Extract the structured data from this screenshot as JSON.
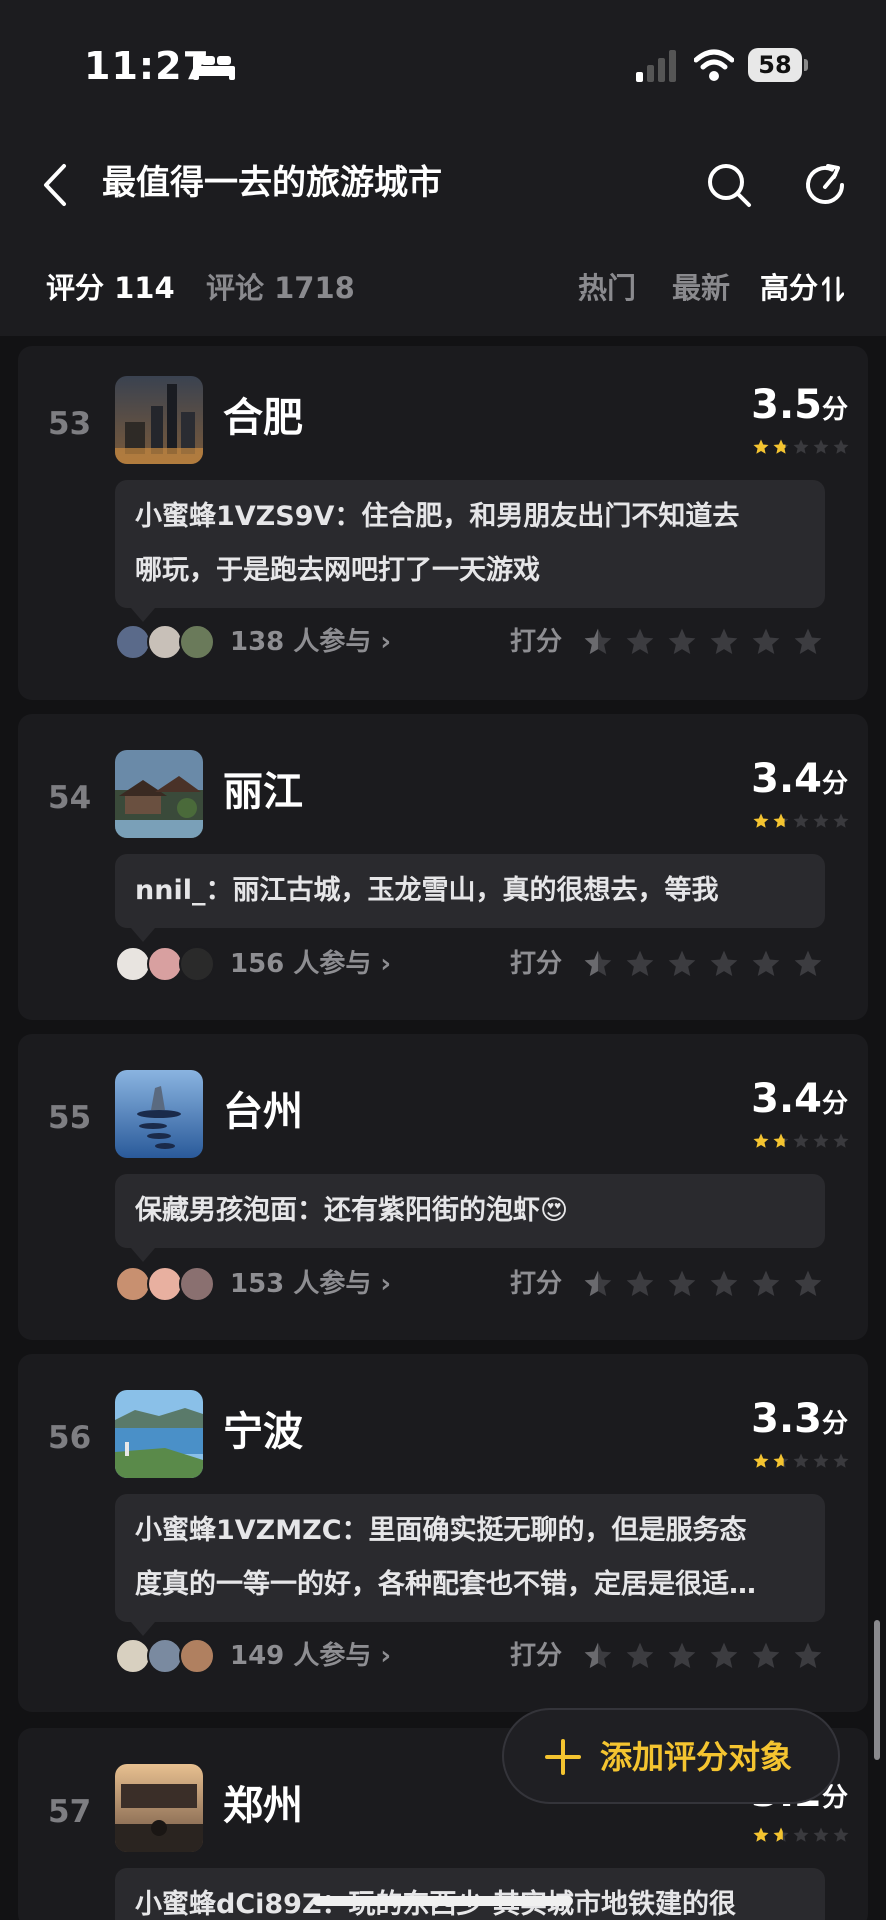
{
  "status": {
    "time": "11:27",
    "battery": "58"
  },
  "header": {
    "title": "最值得一去的旅游城市"
  },
  "tabs": {
    "ratings": "评分 114",
    "comments": "评论 1718",
    "sort_hot": "热门",
    "sort_new": "最新",
    "sort_high": "高分"
  },
  "common": {
    "score_unit": "分",
    "rate_label": "打分"
  },
  "cards": [
    {
      "rank": "53",
      "city": "合肥",
      "score": "3.5",
      "comment_lines": [
        "小蜜蜂1VZS9V：住合肥，和男朋友出门不知道去",
        "哪玩，于是跑去网吧打了一天游戏"
      ],
      "participants": "138 人参与"
    },
    {
      "rank": "54",
      "city": "丽江",
      "score": "3.4",
      "comment_lines": [
        "nnil_：丽江古城，玉龙雪山，真的很想去，等我"
      ],
      "participants": "156 人参与"
    },
    {
      "rank": "55",
      "city": "台州",
      "score": "3.4",
      "comment_lines": [
        "保藏男孩泡面：还有紫阳街的泡虾😍"
      ],
      "participants": "153 人参与"
    },
    {
      "rank": "56",
      "city": "宁波",
      "score": "3.3",
      "comment_lines": [
        "小蜜蜂1VZMZC：里面确实挺无聊的，但是服务态",
        "度真的一等一的好，各种配套也不错，定居是很适…"
      ],
      "participants": "149 人参与"
    },
    {
      "rank": "57",
      "city": "郑州",
      "score": "3.2",
      "comment_lines": [
        "小蜜蜂dCi89Z：玩的东西少 其实城市地铁建的很"
      ],
      "participants": ""
    }
  ],
  "fab": {
    "label": "添加评分对象"
  },
  "colors": {
    "accent": "#f4c430",
    "background": "#121214",
    "card": "#1b1b1e",
    "bubble": "#2a2a2e"
  }
}
